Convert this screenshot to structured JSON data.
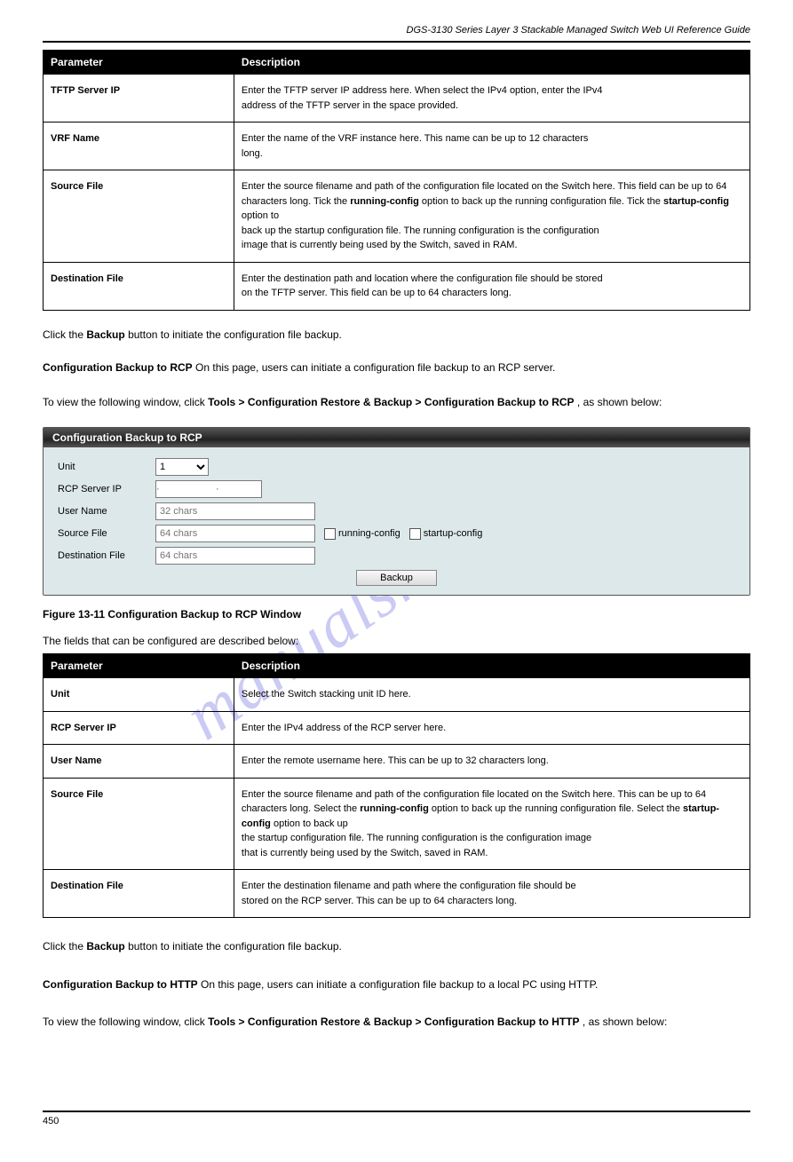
{
  "watermark": "manualshive.com",
  "header": {
    "text": "DGS-3130 Series Layer 3 Stackable Managed Switch Web UI Reference Guide"
  },
  "table1": {
    "head": {
      "param": "Parameter",
      "desc": "Description"
    },
    "rows": [
      {
        "param": "TFTP Server IP",
        "d0": "Enter the TFTP server IP address here. When select the IPv4 option, enter the IPv4",
        "d1": "address of the TFTP server in the space provided."
      },
      {
        "param": "VRF Name",
        "d0": "Enter the name of the VRF instance here. This name can be up to 12 characters",
        "d1": "long."
      },
      {
        "param": "Source File",
        "b0": "running-config",
        "b1": "startup-config",
        "d0": "Enter the source filename and path of the configuration file located on the Switch here. This field can be up to 64 characters long. Tick the",
        "d1": "option to back up the running configuration file. Tick the",
        "d2": "option to",
        "d3": "back up the startup configuration file. The running configuration is the configuration",
        "d4": "image that is currently being used by the Switch, saved in RAM."
      },
      {
        "param": "Destination File",
        "d0": "Enter the destination path and location where the configuration file should be stored",
        "d1": "on the TFTP server. This field can be up to 64 characters long."
      }
    ]
  },
  "afterTable1": {
    "l0a": "Click the",
    "l0b": "Backup",
    "l0c": "button to initiate the configuration file backup."
  },
  "rcpSection": {
    "sub": "Configuration Backup to RCP",
    "intro": "On this page, users can initiate a configuration file backup to an RCP server.",
    "nav0": "To view the following window, click",
    "navBold": "Tools > Configuration Restore & Backup > Configuration Backup to RCP",
    "nav1": ", as shown below:"
  },
  "panel": {
    "title": "Configuration Backup to RCP",
    "labels": {
      "unit": "Unit",
      "rcpServerIp": "RCP Server IP",
      "userName": "User Name",
      "sourceFile": "Source File",
      "destinationFile": "Destination File"
    },
    "values": {
      "unit": "1",
      "ipDots": "·     ·     ·"
    },
    "placeholders": {
      "userName": "32 chars",
      "sourceFile": "64 chars",
      "destinationFile": "64 chars"
    },
    "checkboxes": {
      "running": "running-config",
      "startup": "startup-config"
    },
    "buttons": {
      "backup": "Backup"
    }
  },
  "figure": {
    "caption": "Figure 13-11 Configuration Backup to RCP Window",
    "after": "The fields that can be configured are described below:"
  },
  "table2": {
    "head": {
      "param": "Parameter",
      "desc": "Description"
    },
    "rows": [
      {
        "param": "Unit",
        "d0": "Select the Switch stacking unit ID here."
      },
      {
        "param": "RCP Server IP",
        "d0": "Enter the IPv4 address of the RCP server here."
      },
      {
        "param": "User Name",
        "d0": "Enter the remote username here. This can be up to 32 characters long."
      },
      {
        "param": "Source File",
        "b0": "running-config",
        "b1": "startup-config",
        "d0": "Enter the source filename and path of the configuration file located on the Switch here. This can be up to 64 characters long. Select the",
        "d1": "option to back up the running configuration file. Select the",
        "d2": "option to back up",
        "d3": "the startup configuration file. The running configuration is the configuration image",
        "d4": "that is currently being used by the Switch, saved in RAM."
      },
      {
        "param": "Destination File",
        "d0": "Enter the destination filename and path where the configuration file should be",
        "d1": "stored on the RCP server. This can be up to 64 characters long."
      }
    ]
  },
  "afterTable2": {
    "l0a": "Click the",
    "l0b": "Backup",
    "l0c": "button to initiate the configuration file backup."
  },
  "httpSection": {
    "sub": "Configuration Backup to HTTP",
    "intro": "On this page, users can initiate a configuration file backup to a local PC using HTTP.",
    "nav0": "To view the following window, click",
    "navBold": "Tools > Configuration Restore & Backup > Configuration Backup to HTTP",
    "nav1": ", as shown below:"
  },
  "footer": {
    "page": "450",
    "doc": ""
  }
}
